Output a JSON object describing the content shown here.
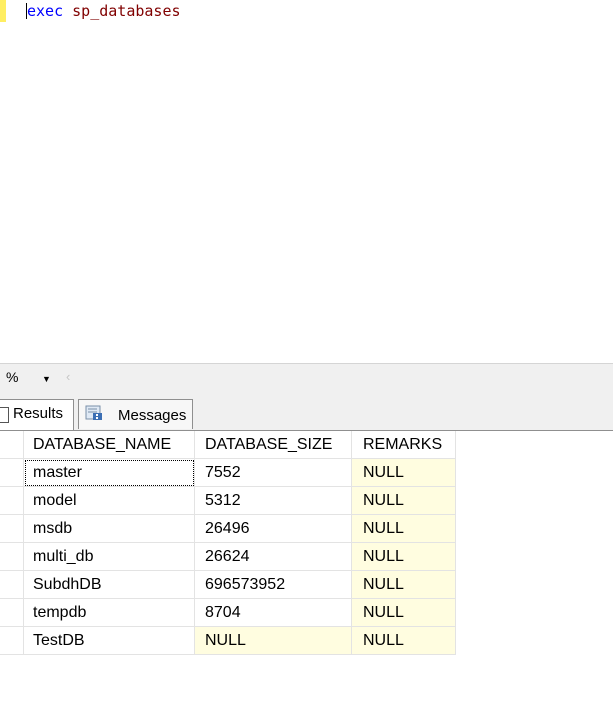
{
  "editor": {
    "keyword": "exec",
    "procedure": "sp_databases"
  },
  "zoom": {
    "value": "%",
    "dropdown_icon": "triangle-down-icon",
    "scroll_icon": "chevron-left-icon"
  },
  "tabs": [
    {
      "label": "Results",
      "icon": "grid-icon",
      "active": true
    },
    {
      "label": "Messages",
      "icon": "messages-icon",
      "active": false
    }
  ],
  "grid": {
    "columns": [
      "DATABASE_NAME",
      "DATABASE_SIZE",
      "REMARKS"
    ],
    "rows": [
      [
        "master",
        "7552",
        "NULL"
      ],
      [
        "model",
        "5312",
        "NULL"
      ],
      [
        "msdb",
        "26496",
        "NULL"
      ],
      [
        "multi_db",
        "26624",
        "NULL"
      ],
      [
        "SubdhDB",
        "696573952",
        "NULL"
      ],
      [
        "tempdb",
        "8704",
        "NULL"
      ],
      [
        "TestDB",
        "NULL",
        "NULL"
      ]
    ]
  },
  "colors": {
    "null_cell": "#fffde0",
    "keyword": "#0000ff",
    "procedure": "#800000",
    "change_marker": "#ffee62"
  }
}
